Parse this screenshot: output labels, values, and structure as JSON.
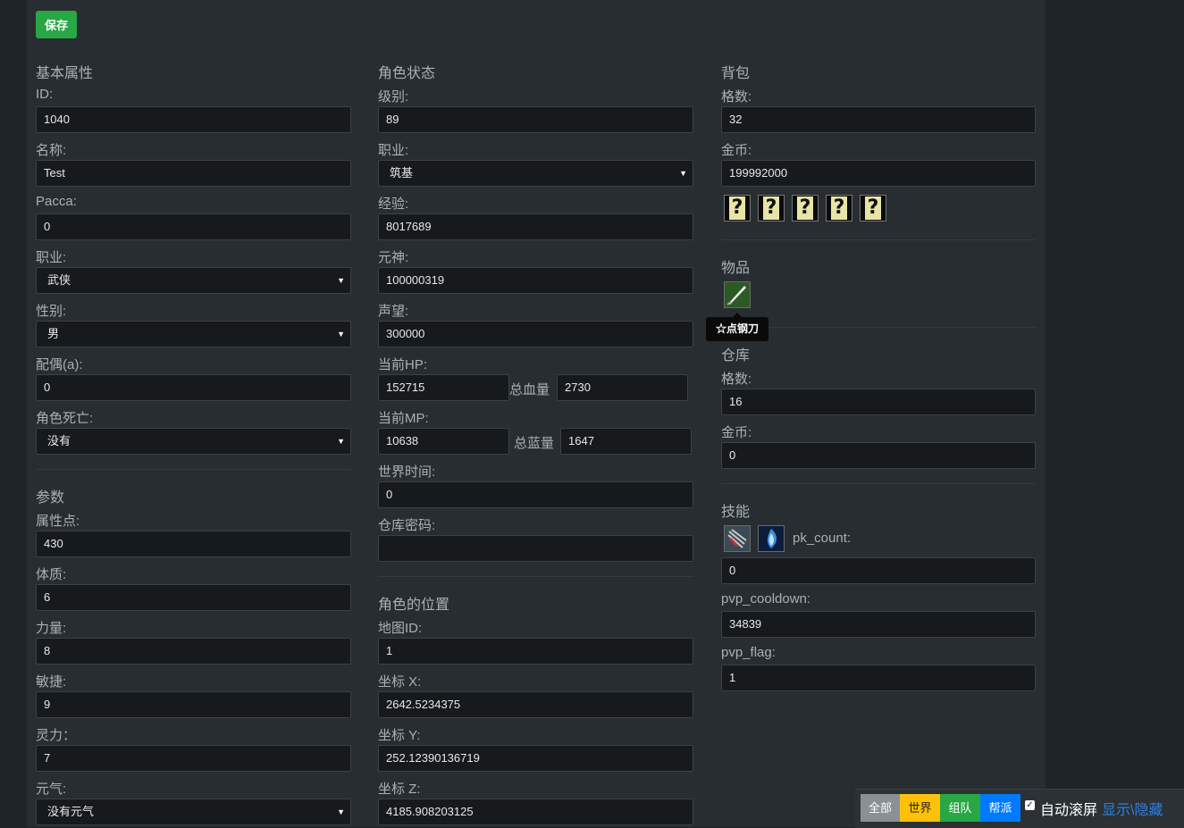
{
  "toolbar": {
    "save_label": "保存"
  },
  "basic": {
    "title": "基本属性",
    "id_label": "ID:",
    "id_value": "1040",
    "name_label": "名称:",
    "name_value": "Test",
    "pacca_label": "Pacca:",
    "pacca_value": "0",
    "class_label": "职业:",
    "class_value": "武侠",
    "gender_label": "性别:",
    "gender_value": "男",
    "spouse_label": "配偶(a):",
    "spouse_value": "0",
    "dead_label": "角色死亡:",
    "dead_value": "没有"
  },
  "params": {
    "title": "参数",
    "attr_label": "属性点:",
    "attr_value": "430",
    "con_label": "体质:",
    "con_value": "6",
    "str_label": "力量:",
    "str_value": "8",
    "agi_label": "敏捷:",
    "agi_value": "9",
    "spi_label": "灵力：",
    "spi_value": "7",
    "qi_label": "元气:",
    "qi_value": "没有元气"
  },
  "status": {
    "title": "角色状态",
    "level_label": "级别:",
    "level_value": "89",
    "class_label": "职业:",
    "class_value": "筑基",
    "exp_label": "经验:",
    "exp_value": "8017689",
    "spirit_label": "元神:",
    "spirit_value": "100000319",
    "rep_label": "声望:",
    "rep_value": "300000",
    "hp_label": "当前HP:",
    "hp_value": "152715",
    "hp_total_label": "总血量",
    "hp_total_value": "2730",
    "mp_label": "当前MP:",
    "mp_value": "10638",
    "mp_total_label": "总蓝量",
    "mp_total_value": "1647",
    "world_time_label": "世界时间:",
    "world_time_value": "0",
    "storage_pw_label": "仓库密码:",
    "storage_pw_value": ""
  },
  "position": {
    "title": "角色的位置",
    "map_label": "地图ID:",
    "map_value": "1",
    "x_label": "坐标 X:",
    "x_value": "2642.5234375",
    "y_label": "坐标 Y:",
    "y_value": "252.12390136719",
    "z_label": "坐标 Z:",
    "z_value": "4185.908203125"
  },
  "bag": {
    "title": "背包",
    "slots_label": "格数:",
    "slots_value": "32",
    "gold_label": "金币:",
    "gold_value": "199992000",
    "unknown_items": [
      "?",
      "?",
      "?",
      "?",
      "?"
    ]
  },
  "items": {
    "title": "物品",
    "tooltip": "☆点钢刀"
  },
  "warehouse": {
    "title": "仓库",
    "slots_label": "格数:",
    "slots_value": "16",
    "gold_label": "金币:",
    "gold_value": "0"
  },
  "skills": {
    "title": "技能",
    "pk_count_label": "pk_count:",
    "pk_count_value": "0",
    "pvp_cooldown_label": "pvp_cooldown:",
    "pvp_cooldown_value": "34839",
    "pvp_flag_label": "pvp_flag:",
    "pvp_flag_value": "1"
  },
  "chat": {
    "all": "全部",
    "world": "世界",
    "team": "组队",
    "guild": "帮派",
    "autoscroll_label": "自动滚屏",
    "autoscroll_checked": true,
    "show_hide": "显示\\隐藏",
    "colors": {
      "all": "#8a9096",
      "world": "#ffc107",
      "team": "#28a745",
      "guild": "#007bff",
      "link": "#2f7fe0"
    }
  }
}
